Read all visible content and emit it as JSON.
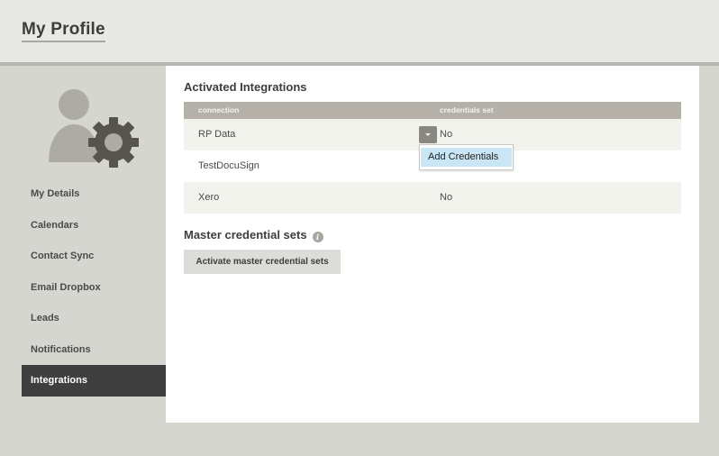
{
  "header": {
    "title": "My Profile"
  },
  "sidebar": {
    "items": [
      {
        "label": "My Details",
        "active": false
      },
      {
        "label": "Calendars",
        "active": false
      },
      {
        "label": "Contact Sync",
        "active": false
      },
      {
        "label": "Email Dropbox",
        "active": false
      },
      {
        "label": "Leads",
        "active": false
      },
      {
        "label": "Notifications",
        "active": false
      },
      {
        "label": "Integrations",
        "active": true
      }
    ]
  },
  "integrations": {
    "title": "Activated Integrations",
    "columns": [
      "connection",
      "credentials set"
    ],
    "rows": [
      {
        "connection": "RP Data",
        "credentials": "No"
      },
      {
        "connection": "TestDocuSign",
        "credentials": ""
      },
      {
        "connection": "Xero",
        "credentials": "No"
      }
    ],
    "dropdown": {
      "options": [
        "Add Credentials"
      ]
    }
  },
  "master": {
    "title": "Master credential sets",
    "info_glyph": "i",
    "button_label": "Activate master credential sets"
  },
  "colors": {
    "active_nav": "#3f3f3f",
    "table_header": "#b5b0a8",
    "dropdown_highlight": "#c9e6f6"
  }
}
